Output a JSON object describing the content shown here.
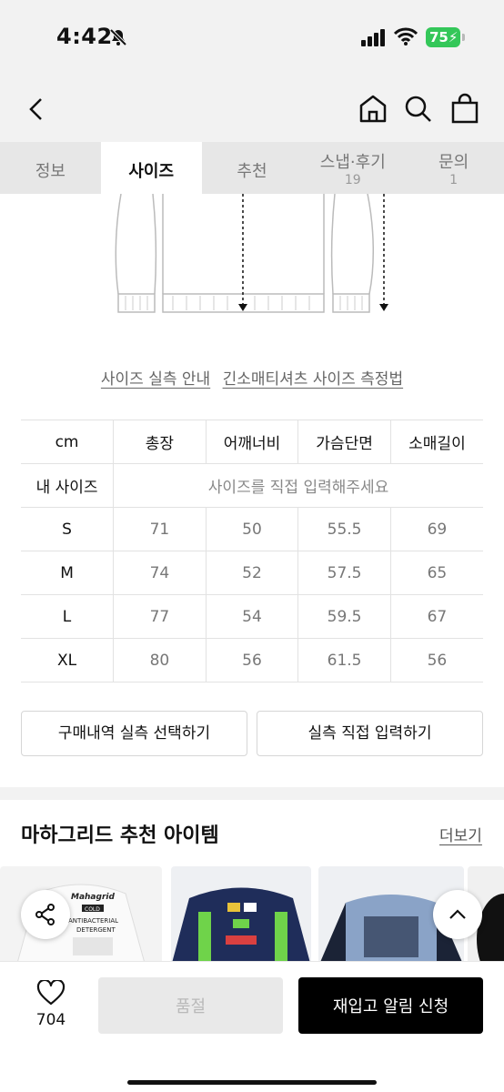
{
  "status_bar": {
    "time": "4:42",
    "battery": "75"
  },
  "tabs": [
    {
      "label": "정보",
      "count": ""
    },
    {
      "label": "사이즈",
      "count": ""
    },
    {
      "label": "추천",
      "count": ""
    },
    {
      "label": "스냅·후기",
      "count": "19"
    },
    {
      "label": "문의",
      "count": "1"
    }
  ],
  "guides": {
    "actual_size": "사이즈 실측 안내",
    "measure": "긴소매티셔츠 사이즈 측정법"
  },
  "size_table": {
    "headers": [
      "cm",
      "총장",
      "어깨너비",
      "가슴단면",
      "소매길이"
    ],
    "my_size_label": "내 사이즈",
    "my_size_placeholder": "사이즈를 직접 입력해주세요",
    "rows": [
      {
        "size": "S",
        "values": [
          "71",
          "50",
          "55.5",
          "69"
        ]
      },
      {
        "size": "M",
        "values": [
          "74",
          "52",
          "57.5",
          "65"
        ]
      },
      {
        "size": "L",
        "values": [
          "77",
          "54",
          "59.5",
          "67"
        ]
      },
      {
        "size": "XL",
        "values": [
          "80",
          "56",
          "61.5",
          "56"
        ]
      }
    ]
  },
  "buttons": {
    "purchase_history": "구매내역 실측 선택하기",
    "direct_input": "실측 직접 입력하기"
  },
  "recommend": {
    "title": "마하그리드 추천 아이템",
    "more": "더보기"
  },
  "products": [
    {
      "text_1": "Mahagrid",
      "text_2": "COLD",
      "text_3": "ANTIBACTERIAL",
      "text_4": "DETERGENT"
    }
  ],
  "bottom": {
    "likes": "704",
    "soldout": "품절",
    "restock": "재입고 알림 신청"
  },
  "colors": {
    "accent": "#000000",
    "battery": "#34c759",
    "tab_bg": "#e7e7e7"
  }
}
